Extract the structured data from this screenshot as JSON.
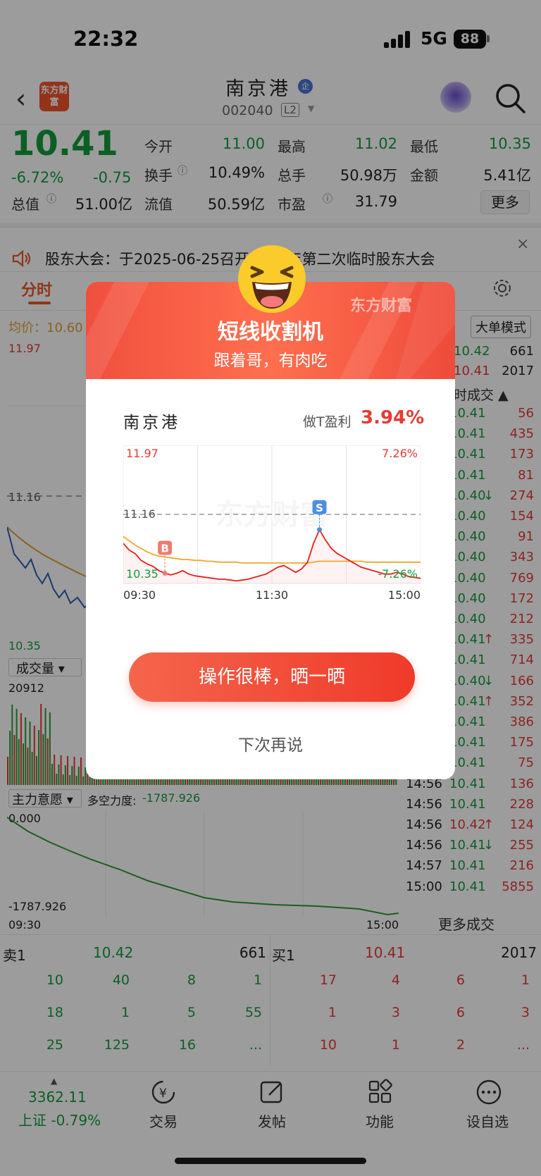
{
  "status_bar": {
    "time": "22:32",
    "network": "5G",
    "battery": "88"
  },
  "header": {
    "stock_name": "南京港",
    "stock_code": "002040",
    "level": "L2",
    "logo_text": "东方财富",
    "badge": "企"
  },
  "quote": {
    "price": "10.41",
    "change_pct": "-6.72%",
    "change": "-0.75",
    "fields": [
      {
        "label": "今开",
        "value": "11.00"
      },
      {
        "label": "最高",
        "value": "11.02"
      },
      {
        "label": "最低",
        "value": "10.35"
      },
      {
        "label": "换手",
        "value": "10.49%"
      },
      {
        "label": "总手",
        "value": "50.98万"
      },
      {
        "label": "金额",
        "value": "5.41亿"
      },
      {
        "label": "总值",
        "value": "51.00亿"
      },
      {
        "label": "流值",
        "value": "50.59亿"
      },
      {
        "label": "市盈",
        "value": "31.79"
      }
    ],
    "more_label": "更多"
  },
  "notice": {
    "text": "股东大会：于2025-06-25召开2025年第二次临时股东大会"
  },
  "tabs": {
    "active": "分时"
  },
  "chart_bg": {
    "avg_label": "均价：10.60",
    "high": "11.97",
    "ref": "11.16",
    "low": "10.35",
    "volume_label": "成交量",
    "volume_max": "20912",
    "main_force_label": "主力意愿",
    "long_short_label": "多空力度:",
    "long_short_value": "-1787.926",
    "mf_top": "0.000",
    "mf_bottom": "-1787.926",
    "time_start": "09:30",
    "time_end": "15:00",
    "big_order": "大单模式"
  },
  "right_panel": {
    "top_rows": [
      {
        "price": "10.42",
        "vol": "661"
      },
      {
        "price": "10.41",
        "vol": "2017"
      }
    ],
    "header": "时成交",
    "ticks": [
      {
        "time": "",
        "price": "10.41",
        "vol": "56",
        "dir": ""
      },
      {
        "time": "",
        "price": "10.41",
        "vol": "435",
        "dir": ""
      },
      {
        "time": "",
        "price": "10.41",
        "vol": "173",
        "dir": ""
      },
      {
        "time": "",
        "price": "10.41",
        "vol": "81",
        "dir": ""
      },
      {
        "time": "",
        "price": "10.40",
        "vol": "274",
        "dir": "↓"
      },
      {
        "time": "",
        "price": "10.40",
        "vol": "154",
        "dir": ""
      },
      {
        "time": "",
        "price": "10.40",
        "vol": "91",
        "dir": ""
      },
      {
        "time": "",
        "price": "10.40",
        "vol": "343",
        "dir": ""
      },
      {
        "time": "",
        "price": "10.40",
        "vol": "769",
        "dir": ""
      },
      {
        "time": "",
        "price": "10.40",
        "vol": "172",
        "dir": ""
      },
      {
        "time": "",
        "price": "10.40",
        "vol": "212",
        "dir": ""
      },
      {
        "time": "",
        "price": "10.41",
        "vol": "335",
        "dir": "↑"
      },
      {
        "time": "",
        "price": "10.41",
        "vol": "714",
        "dir": ""
      },
      {
        "time": "",
        "price": "10.40",
        "vol": "166",
        "dir": "↓"
      },
      {
        "time": "",
        "price": "10.41",
        "vol": "352",
        "dir": "↑"
      },
      {
        "time": "",
        "price": "10.41",
        "vol": "386",
        "dir": ""
      },
      {
        "time": "",
        "price": "10.41",
        "vol": "175",
        "dir": ""
      },
      {
        "time": "",
        "price": "10.41",
        "vol": "75",
        "dir": ""
      },
      {
        "time": "14:56",
        "price": "10.41",
        "vol": "136",
        "dir": ""
      },
      {
        "time": "14:56",
        "price": "10.41",
        "vol": "228",
        "dir": ""
      },
      {
        "time": "14:56",
        "price": "10.42",
        "vol": "124",
        "dir": "↑"
      },
      {
        "time": "14:56",
        "price": "10.41",
        "vol": "255",
        "dir": "↓"
      },
      {
        "time": "14:57",
        "price": "10.41",
        "vol": "216",
        "dir": ""
      },
      {
        "time": "15:00",
        "price": "10.41",
        "vol": "5855",
        "dir": ""
      }
    ],
    "more_trades": "更多成交"
  },
  "order_book": {
    "sell_label": "卖1",
    "sell_price": "10.42",
    "sell_vol": "661",
    "buy_label": "买1",
    "buy_price": "10.41",
    "buy_vol": "2017",
    "sell_queue": [
      [
        "10",
        "40",
        "8",
        "1"
      ],
      [
        "18",
        "1",
        "5",
        "55"
      ],
      [
        "25",
        "125",
        "16",
        "..."
      ]
    ],
    "buy_queue": [
      [
        "17",
        "4",
        "6",
        "1"
      ],
      [
        "1",
        "3",
        "6",
        "3"
      ],
      [
        "10",
        "1",
        "2",
        "..."
      ]
    ]
  },
  "bottom_nav": {
    "index_value": "3362.11",
    "index_label": "上证 -0.79%",
    "items": [
      "交易",
      "发帖",
      "功能",
      "设自选"
    ]
  },
  "modal": {
    "title": "短线收割机",
    "subtitle": "跟着哥，有肉吃",
    "brand": "东方财富",
    "stock_name": "南京港",
    "profit_label": "做T盈利",
    "profit_value": "3.94%",
    "share_button": "操作很棒，晒一晒",
    "later_button": "下次再说"
  },
  "chart_data": {
    "type": "line",
    "title": "",
    "x_ticks": [
      "09:30",
      "11:30",
      "15:00"
    ],
    "y_labels": {
      "high": "11.97",
      "ref": "11.16",
      "low": "10.35",
      "high_pct": "7.26%",
      "low_pct": "-7.26%"
    },
    "ylim": [
      10.35,
      11.97
    ],
    "reference": 11.16,
    "series": [
      {
        "name": "",
        "color": "#e8201b",
        "values": [
          10.82,
          10.74,
          10.7,
          10.62,
          10.58,
          10.55,
          10.5,
          10.47,
          10.45,
          10.47,
          10.5,
          10.46,
          10.44,
          10.43,
          10.42,
          10.41,
          10.4,
          10.4,
          10.39,
          10.38,
          10.39,
          10.4,
          10.42,
          10.44,
          10.46,
          10.5,
          10.54,
          10.56,
          10.52,
          10.48,
          10.52,
          10.6,
          10.82,
          10.98,
          10.86,
          10.76,
          10.7,
          10.66,
          10.62,
          10.58,
          10.54,
          10.52,
          10.5,
          10.48,
          10.46,
          10.46,
          10.48,
          10.46,
          10.43,
          10.42,
          10.41
        ]
      },
      {
        "name": "",
        "color": "#f0a62a",
        "values": [
          10.9,
          10.85,
          10.8,
          10.76,
          10.72,
          10.69,
          10.67,
          10.66,
          10.65,
          10.64,
          10.63,
          10.63,
          10.62,
          10.62,
          10.61,
          10.61,
          10.6,
          10.6,
          10.6,
          10.6,
          10.59,
          10.59,
          10.59,
          10.59,
          10.59,
          10.59,
          10.59,
          10.59,
          10.59,
          10.59,
          10.59,
          10.59,
          10.6,
          10.61,
          10.61,
          10.61,
          10.61,
          10.61,
          10.61,
          10.61,
          10.61,
          10.6,
          10.6,
          10.6,
          10.6,
          10.6,
          10.6,
          10.6,
          10.6,
          10.6,
          10.6
        ]
      }
    ],
    "markers": [
      {
        "label": "B",
        "index": 7,
        "color": "#ef7b73"
      },
      {
        "label": "S",
        "index": 33,
        "color": "#4c8fe0"
      }
    ],
    "watermark": "东方财富",
    "grid": true
  }
}
